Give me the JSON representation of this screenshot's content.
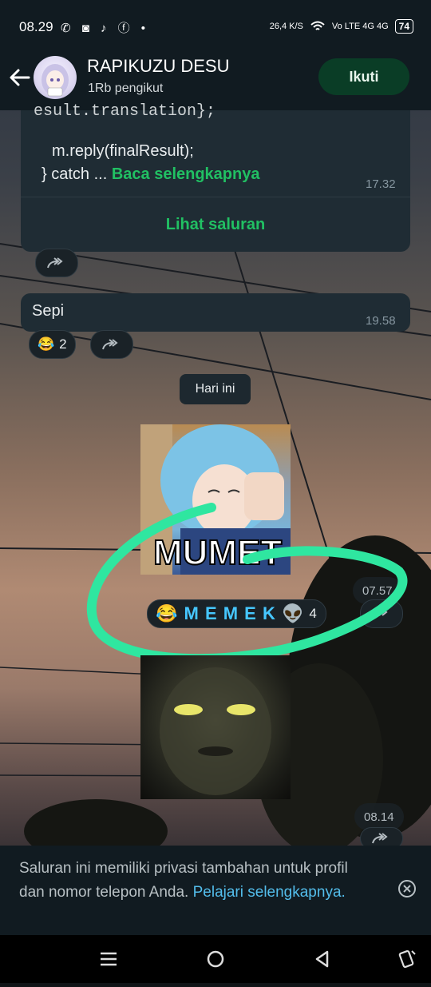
{
  "status_bar": {
    "time": "08.29",
    "app_icons": "✆ ◙ ♪ ⓕ •",
    "net_speed": "26,4 K/S",
    "network": "Vo LTE 4G 4G",
    "battery": "74"
  },
  "header": {
    "title": "RAPIKUZU DESU",
    "subtitle": "1Rb pengikut",
    "follow_label": "Ikuti"
  },
  "messages": {
    "code_partial": "esult.translation};",
    "code_line1": "m.reply(finalResult);",
    "code_line2": "} catch ...",
    "read_more": "Baca selengkapnya",
    "code_time": "17.32",
    "view_channel": "Lihat saluran",
    "sepi_text": "Sepi",
    "sepi_time": "19.58",
    "sepi_reaction_emoji": "😂",
    "sepi_reaction_count": "2",
    "date_chip": "Hari ini",
    "sticker1_text": "MUMET",
    "sticker1_time": "07.57",
    "sticker1_reaction": "😂 M E M E K 👽",
    "sticker1_reaction_count": "4",
    "sticker2_time": "08.14"
  },
  "privacy": {
    "text": "Saluran ini memiliki privasi tambahan untuk profil dan nomor telepon Anda. ",
    "link": "Pelajari selengkapnya."
  },
  "colors": {
    "accent_green": "#21c063",
    "link_blue": "#53bdeb",
    "highlight_stroke": "#2fe6a0"
  }
}
